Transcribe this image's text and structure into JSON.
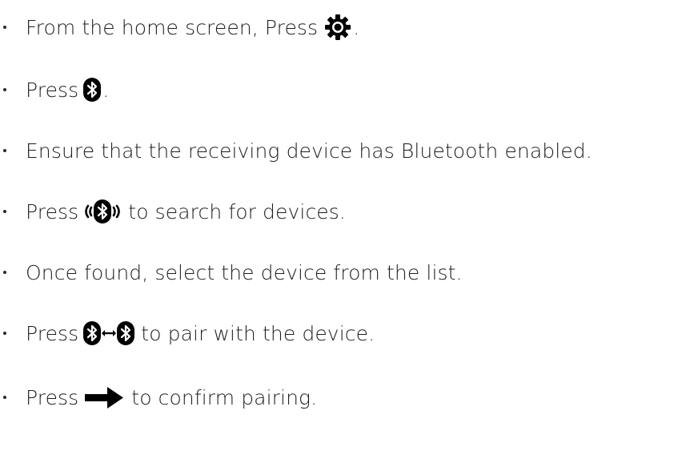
{
  "steps": [
    {
      "before": "From the home screen, Press",
      "icon": "gear-icon",
      "after": "."
    },
    {
      "before": "Press",
      "icon": "bluetooth-icon",
      "after": "."
    },
    {
      "before": "Ensure that the receiving device has Bluetooth enabled.",
      "icon": "",
      "after": ""
    },
    {
      "before": "Press",
      "icon": "bluetooth-search-icon",
      "after": "to search for devices."
    },
    {
      "before": "Once found, select the device from the list.",
      "icon": "",
      "after": ""
    },
    {
      "before": "Press",
      "icon": "bluetooth-pair-icon",
      "after": "to pair with the device."
    },
    {
      "before": "Press",
      "icon": "arrow-right-icon",
      "after": "to confirm pairing."
    }
  ],
  "colors": {
    "text": "#1f1f1f",
    "icon": "#000000"
  }
}
